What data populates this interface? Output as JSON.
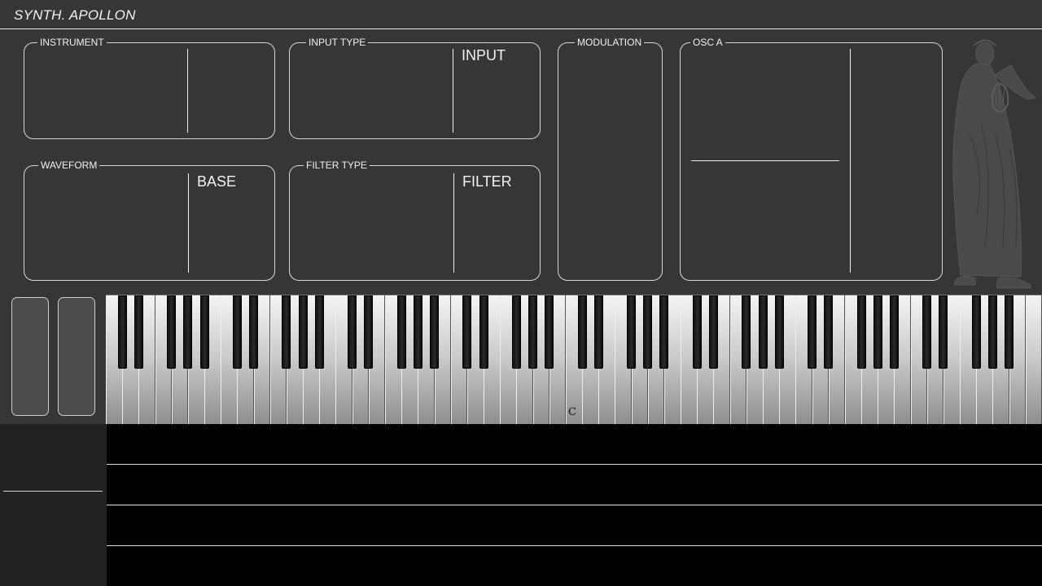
{
  "app": {
    "title": "SYNTH. APOLLON"
  },
  "panels": {
    "instrument": {
      "legend": "INSTRUMENT",
      "value": ""
    },
    "input_type": {
      "legend": "INPUT TYPE",
      "value": "INPUT"
    },
    "modulation": {
      "legend": "MODULATION"
    },
    "osc_a": {
      "legend": "OSC A"
    },
    "waveform": {
      "legend": "WAVEFORM",
      "value": "BASE"
    },
    "filter_type": {
      "legend": "FILTER TYPE",
      "value": "FILTER"
    }
  },
  "keyboard": {
    "middle_c_label": "C"
  },
  "tracks": {
    "count": 4
  },
  "colors": {
    "background": "#363636",
    "line": "#f0f0f0",
    "tracks": "#000000"
  },
  "icons": [
    "apollo-statue-icon"
  ]
}
